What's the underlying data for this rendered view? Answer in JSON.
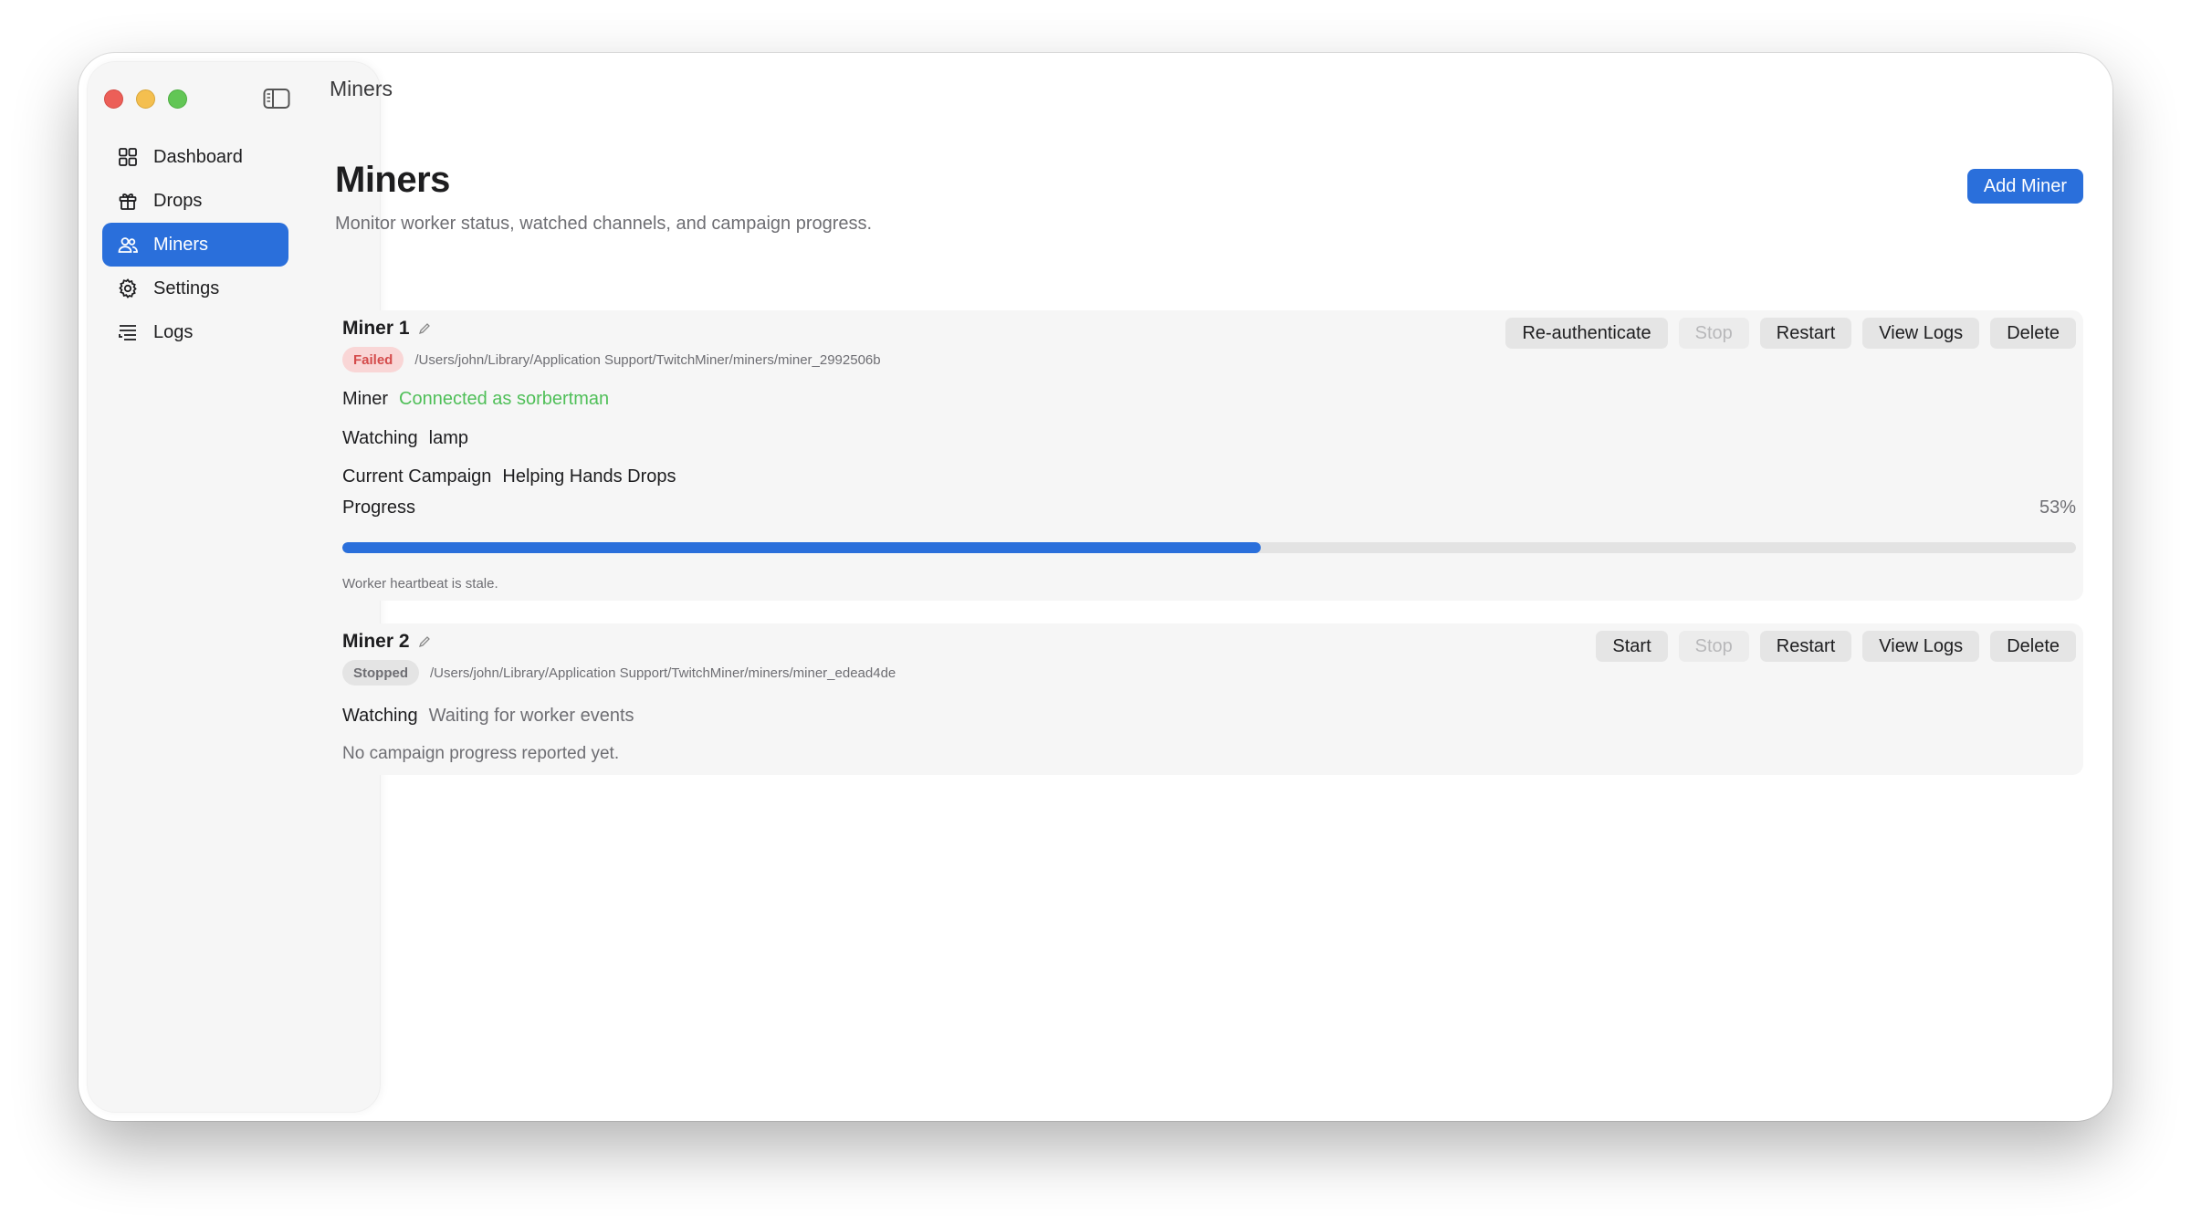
{
  "window": {
    "toolbar_title": "Miners"
  },
  "sidebar": {
    "items": [
      {
        "label": "Dashboard",
        "icon": "grid-icon",
        "active": false
      },
      {
        "label": "Drops",
        "icon": "gift-icon",
        "active": false
      },
      {
        "label": "Miners",
        "icon": "users-icon",
        "active": true
      },
      {
        "label": "Settings",
        "icon": "gear-icon",
        "active": false
      },
      {
        "label": "Logs",
        "icon": "list-icon",
        "active": false
      }
    ]
  },
  "page": {
    "title": "Miners",
    "subtitle": "Monitor worker status, watched channels, and campaign progress.",
    "add_button": "Add Miner"
  },
  "miners": [
    {
      "name": "Miner 1",
      "status": "Failed",
      "path": "/Users/john/Library/Application Support/TwitchMiner/miners/miner_2992506b",
      "actions": [
        "Re-authenticate",
        "Stop",
        "Restart",
        "View Logs",
        "Delete"
      ],
      "disabled_actions": [
        "Stop"
      ],
      "miner_label": "Miner",
      "miner_value": "Connected as sorbertman",
      "watching_label": "Watching",
      "watching_value": "lamp",
      "campaign_label": "Current Campaign",
      "campaign_value": "Helping Hands Drops",
      "progress_label": "Progress",
      "progress_text": "53%",
      "progress_fraction": 0.53,
      "note": "Worker heartbeat is stale."
    },
    {
      "name": "Miner 2",
      "status": "Stopped",
      "path": "/Users/john/Library/Application Support/TwitchMiner/miners/miner_edead4de",
      "actions": [
        "Start",
        "Stop",
        "Restart",
        "View Logs",
        "Delete"
      ],
      "disabled_actions": [
        "Stop"
      ],
      "watching_label": "Watching",
      "watching_value": "Waiting for worker events",
      "note": "No campaign progress reported yet."
    }
  ],
  "colors": {
    "accent": "#2a6fdb",
    "connected": "#4fbf58",
    "failed_badge_bg": "#f9d6d6",
    "failed_badge_text": "#d44b4b"
  }
}
